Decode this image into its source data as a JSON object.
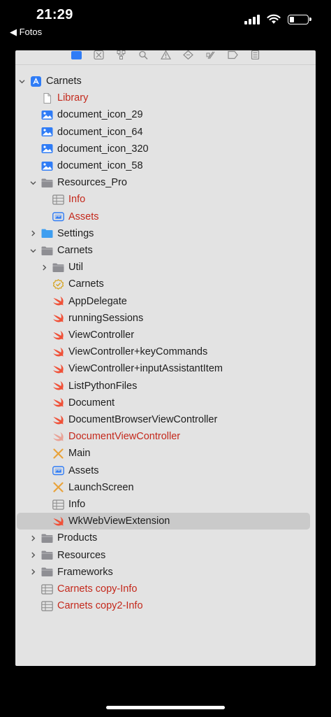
{
  "status_bar": {
    "time": "21:29",
    "back_label": "◀ Fotos"
  },
  "navigator": {
    "toolbar_icons": [
      "folder-icon",
      "source-control-icon",
      "hierarchy-icon",
      "search-icon",
      "warning-icon",
      "test-icon",
      "debug-icon",
      "breakpoint-icon",
      "report-icon"
    ],
    "rows": [
      {
        "label": "Carnets",
        "icon": "app-project",
        "red": false,
        "chevron": "down",
        "indent": 0
      },
      {
        "label": "Library",
        "icon": "file",
        "red": true,
        "chevron": "none",
        "indent": 1
      },
      {
        "label": "document_icon_29",
        "icon": "image",
        "red": false,
        "chevron": "none",
        "indent": 1
      },
      {
        "label": "document_icon_64",
        "icon": "image",
        "red": false,
        "chevron": "none",
        "indent": 1
      },
      {
        "label": "document_icon_320",
        "icon": "image",
        "red": false,
        "chevron": "none",
        "indent": 1
      },
      {
        "label": "document_icon_58",
        "icon": "image",
        "red": false,
        "chevron": "none",
        "indent": 1
      },
      {
        "label": "Resources_Pro",
        "icon": "folder-gray",
        "red": false,
        "chevron": "down",
        "indent": 1
      },
      {
        "label": "Info",
        "icon": "plist",
        "red": true,
        "chevron": "none",
        "indent": 2
      },
      {
        "label": "Assets",
        "icon": "assets",
        "red": true,
        "chevron": "none",
        "indent": 2
      },
      {
        "label": "Settings",
        "icon": "folder-blue",
        "red": false,
        "chevron": "right",
        "indent": 1
      },
      {
        "label": "Carnets",
        "icon": "folder-gray",
        "red": false,
        "chevron": "down",
        "indent": 1
      },
      {
        "label": "Util",
        "icon": "folder-gray",
        "red": false,
        "chevron": "right",
        "indent": 2
      },
      {
        "label": "Carnets",
        "icon": "entitlements",
        "red": false,
        "chevron": "none",
        "indent": 2
      },
      {
        "label": "AppDelegate",
        "icon": "swift",
        "red": false,
        "chevron": "none",
        "indent": 2
      },
      {
        "label": "runningSessions",
        "icon": "swift",
        "red": false,
        "chevron": "none",
        "indent": 2
      },
      {
        "label": "ViewController",
        "icon": "swift",
        "red": false,
        "chevron": "none",
        "indent": 2
      },
      {
        "label": "ViewController+keyCommands",
        "icon": "swift",
        "red": false,
        "chevron": "none",
        "indent": 2
      },
      {
        "label": "ViewController+inputAssistantItem",
        "icon": "swift",
        "red": false,
        "chevron": "none",
        "indent": 2
      },
      {
        "label": "ListPythonFiles",
        "icon": "swift",
        "red": false,
        "chevron": "none",
        "indent": 2
      },
      {
        "label": "Document",
        "icon": "swift",
        "red": false,
        "chevron": "none",
        "indent": 2
      },
      {
        "label": "DocumentBrowserViewController",
        "icon": "swift",
        "red": false,
        "chevron": "none",
        "indent": 2
      },
      {
        "label": "DocumentViewController",
        "icon": "swift-faded",
        "red": true,
        "chevron": "none",
        "indent": 2
      },
      {
        "label": "Main",
        "icon": "storyboard",
        "red": false,
        "chevron": "none",
        "indent": 2
      },
      {
        "label": "Assets",
        "icon": "assets",
        "red": false,
        "chevron": "none",
        "indent": 2
      },
      {
        "label": "LaunchScreen",
        "icon": "storyboard",
        "red": false,
        "chevron": "none",
        "indent": 2
      },
      {
        "label": "Info",
        "icon": "plist",
        "red": false,
        "chevron": "none",
        "indent": 2
      },
      {
        "label": "WkWebViewExtension",
        "icon": "swift",
        "red": false,
        "chevron": "none",
        "indent": 2,
        "selected": true
      },
      {
        "label": "Products",
        "icon": "folder-gray",
        "red": false,
        "chevron": "right",
        "indent": 1
      },
      {
        "label": "Resources",
        "icon": "folder-gray",
        "red": false,
        "chevron": "right",
        "indent": 1
      },
      {
        "label": "Frameworks",
        "icon": "folder-gray",
        "red": false,
        "chevron": "right",
        "indent": 1
      },
      {
        "label": "Carnets copy-Info",
        "icon": "plist",
        "red": true,
        "chevron": "none",
        "indent": 1
      },
      {
        "label": "Carnets copy2-Info",
        "icon": "plist",
        "red": true,
        "chevron": "none",
        "indent": 1
      }
    ]
  },
  "colors": {
    "panel_bg": "#e3e3e3",
    "selected_row": "#cacaca",
    "missing_file_red": "#c4291c",
    "swift_orange": "#f05138",
    "folder_gray": "#8e8e93",
    "folder_blue": "#3e9ef0",
    "accent_blue": "#2f7cf6"
  }
}
